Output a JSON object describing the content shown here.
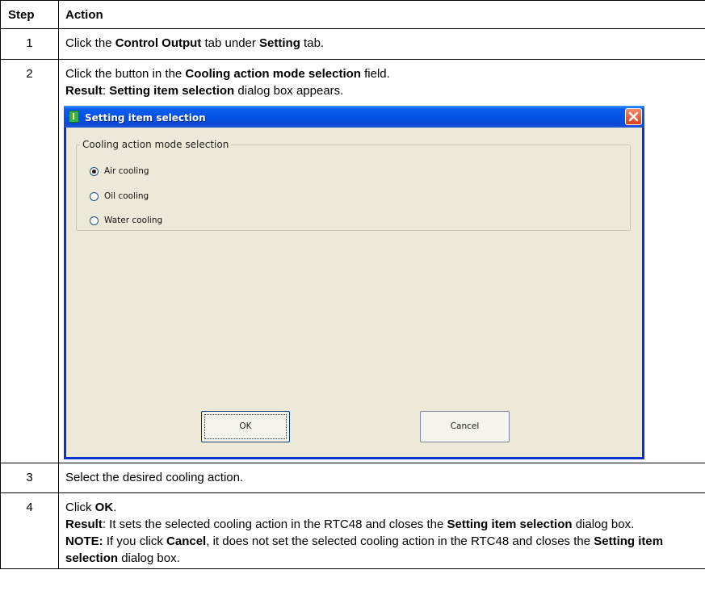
{
  "table": {
    "headers": {
      "step": "Step",
      "action": "Action"
    },
    "rows": [
      {
        "step": "1",
        "parts": [
          "Click the ",
          "Control Output",
          " tab under ",
          "Setting",
          " tab."
        ]
      },
      {
        "step": "2",
        "line1": [
          "Click the button in the ",
          "Cooling action mode selection",
          " field."
        ],
        "line2": [
          "Result",
          ": ",
          "Setting item selection",
          " dialog box appears."
        ]
      },
      {
        "step": "3",
        "text": "Select the desired cooling action."
      },
      {
        "step": "4",
        "line1": [
          "Click ",
          "OK",
          "."
        ],
        "result": [
          "Result",
          ": It sets the selected cooling action in the RTC48 and closes the ",
          "Setting item selection",
          " dialog box."
        ],
        "note": [
          "NOTE:",
          " If you click ",
          "Cancel",
          ", it does not set the selected cooling action in the RTC48 and closes the ",
          "Setting item selection",
          " dialog box."
        ]
      }
    ]
  },
  "dialog": {
    "title": "Setting item selection",
    "group_label": "Cooling action mode selection",
    "options": [
      {
        "label": "Air cooling",
        "selected": true
      },
      {
        "label": "Oil cooling",
        "selected": false
      },
      {
        "label": "Water cooling",
        "selected": false
      }
    ],
    "ok_label": "OK",
    "cancel_label": "Cancel"
  },
  "colors": {
    "titlebar_blue": "#0451e4",
    "dialog_face": "#ece9d8",
    "close_red": "#d9401b"
  }
}
